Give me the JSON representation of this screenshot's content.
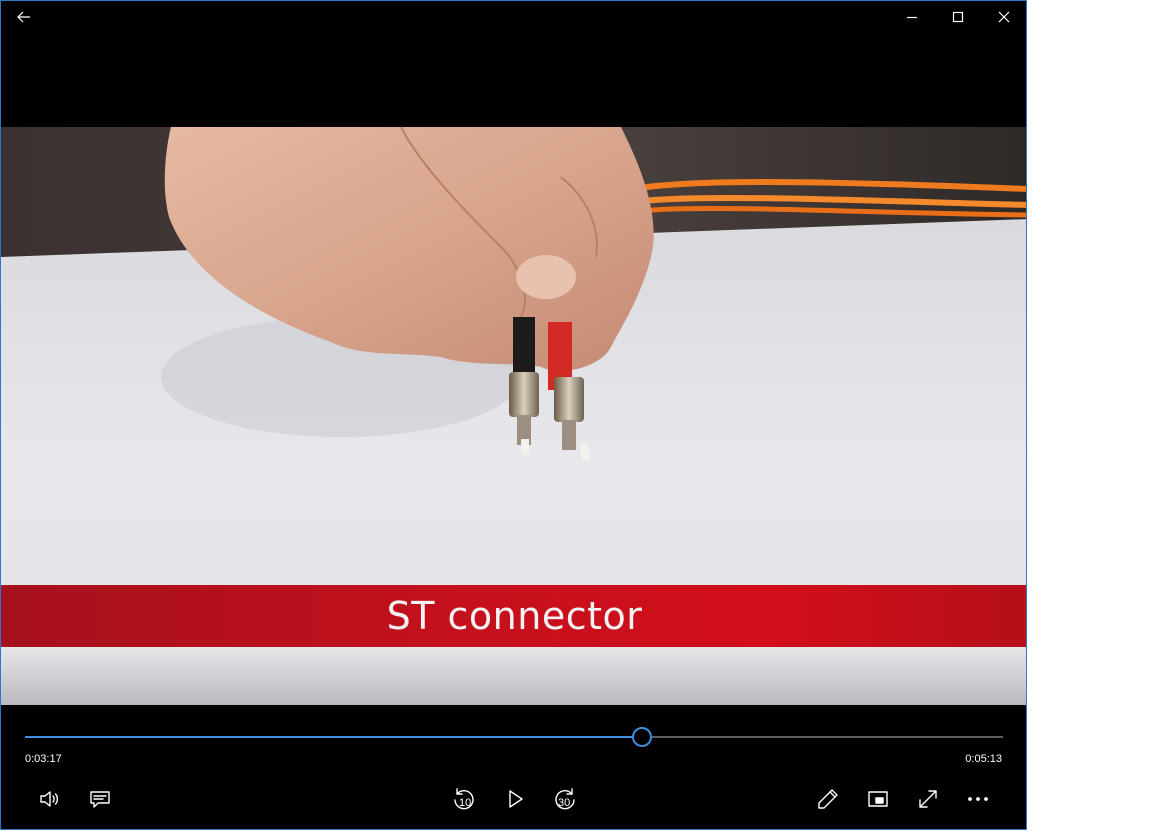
{
  "titlebar": {
    "back_icon": "back-arrow-icon",
    "minimize_icon": "minimize-icon",
    "maximize_icon": "maximize-icon",
    "close_icon": "close-icon"
  },
  "video": {
    "caption": "ST connector"
  },
  "playback": {
    "current_time": "0:03:17",
    "total_time": "0:05:13",
    "progress": 0.6294
  },
  "controls": {
    "skip_back_seconds": "10",
    "skip_forward_seconds": "30",
    "left": [
      "volume-icon",
      "subtitles-icon"
    ],
    "center": [
      "skip-back-10-icon",
      "play-icon",
      "skip-forward-30-icon"
    ],
    "right": [
      "edit-pencil-icon",
      "mini-view-icon",
      "fullscreen-icon",
      "more-options-icon"
    ]
  },
  "colors": {
    "accent": "#3c8ee0",
    "caption_band": "#c5101d",
    "window_border": "#2b78c8"
  }
}
